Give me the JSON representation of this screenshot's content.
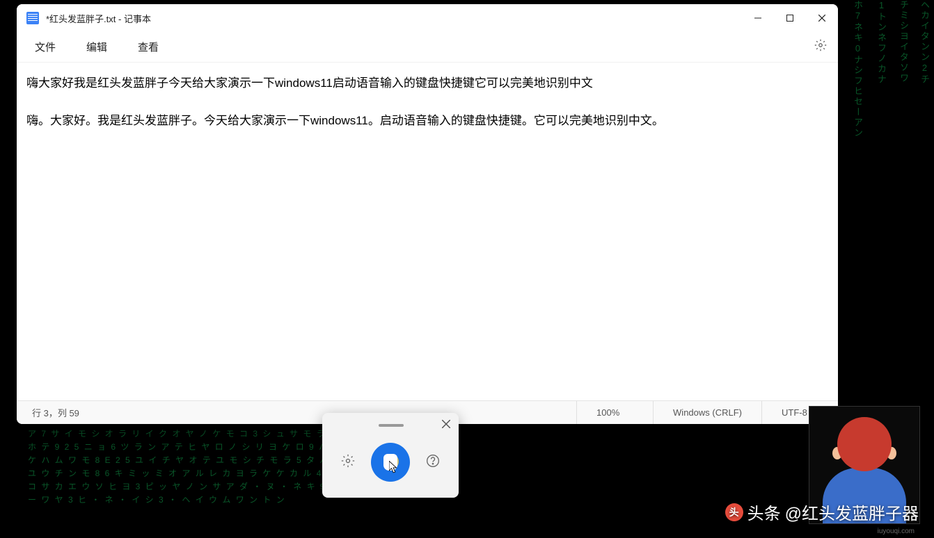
{
  "titlebar": {
    "title": "*红头发蓝胖子.txt - 记事本"
  },
  "menu": {
    "file": "文件",
    "edit": "编辑",
    "view": "查看"
  },
  "editor": {
    "content": "嗨大家好我是红头发蓝胖子今天给大家演示一下windows11启动语音输入的键盘快捷键它可以完美地识别中文\n\n嗨。大家好。我是红头发蓝胖子。今天给大家演示一下windows11。启动语音输入的键盘快捷键。它可以完美地识别中文。"
  },
  "status": {
    "cursor": "行 3，列 59",
    "zoom": "100%",
    "lineend": "Windows (CRLF)",
    "encoding": "UTF-8"
  },
  "watermark": {
    "label": "头条",
    "handle": "@红头发蓝胖子器",
    "small": "iuyouqi.com"
  },
  "matrix": {
    "chars": "ホ7ネキ0ナシフヒセーアンチミシヨイタソワイタンン2チアケハムワモ8E25サオラリチサットユ8エウサカヒヨ3"
  }
}
